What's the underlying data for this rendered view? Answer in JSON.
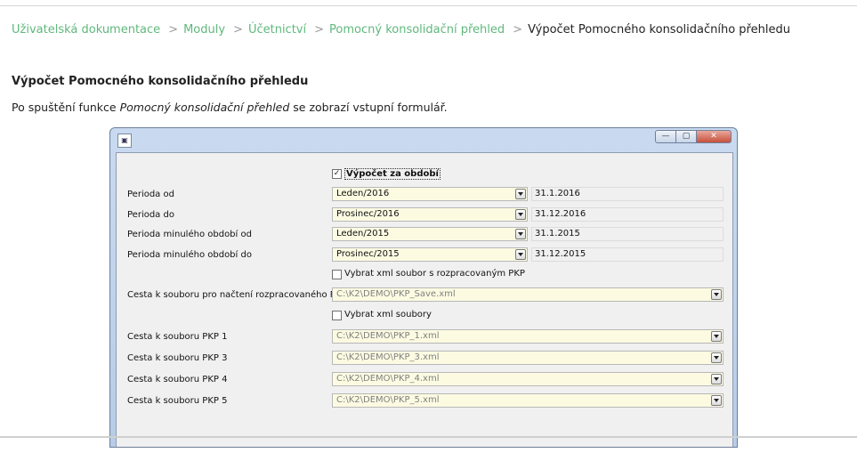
{
  "breadcrumb": {
    "items": [
      "Uživatelská dokumentace",
      "Moduly",
      "Účetnictví",
      "Pomocný konsolidační přehled"
    ],
    "current": "Výpočet Pomocného konsolidačního přehledu"
  },
  "heading": "Výpočet Pomocného konsolidačního přehledu",
  "intro": {
    "before": "Po spuštění funkce ",
    "emphasis": "Pomocný konsolidační přehled",
    "after": " se zobrazí vstupní formulář."
  },
  "window": {
    "icon": "app-icon",
    "controls": {
      "minimize": "—",
      "maximize": "▢",
      "close": "✕"
    },
    "checkbox_period": {
      "label": "Výpočet za období",
      "checked": true
    },
    "rows": [
      {
        "label": "Perioda od",
        "value": "Leden/2016",
        "date": "31.1.2016"
      },
      {
        "label": "Perioda do",
        "value": "Prosinec/2016",
        "date": "31.12.2016"
      },
      {
        "label": "Perioda minulého období od",
        "value": "Leden/2015",
        "date": "31.1.2015"
      },
      {
        "label": "Perioda minulého období do",
        "value": "Prosinec/2015",
        "date": "31.12.2015"
      }
    ],
    "checkbox_xml_save": {
      "label": "Vybrat xml soubor s rozpracovaným PKP",
      "checked": false
    },
    "path_save": {
      "label": "Cesta k souboru pro načtení rozpracovaného PKP",
      "value": "C:\\K2\\DEMO\\PKP_Save.xml"
    },
    "checkbox_xml_files": {
      "label": "Vybrat xml soubory",
      "checked": false
    },
    "paths": [
      {
        "label": "Cesta k souboru PKP 1",
        "value": "C:\\K2\\DEMO\\PKP_1.xml"
      },
      {
        "label": "Cesta k souboru PKP 3",
        "value": "C:\\K2\\DEMO\\PKP_3.xml"
      },
      {
        "label": "Cesta k souboru PKP 4",
        "value": "C:\\K2\\DEMO\\PKP_4.xml"
      },
      {
        "label": "Cesta k souboru PKP 5",
        "value": "C:\\K2\\DEMO\\PKP_5.xml"
      }
    ]
  }
}
